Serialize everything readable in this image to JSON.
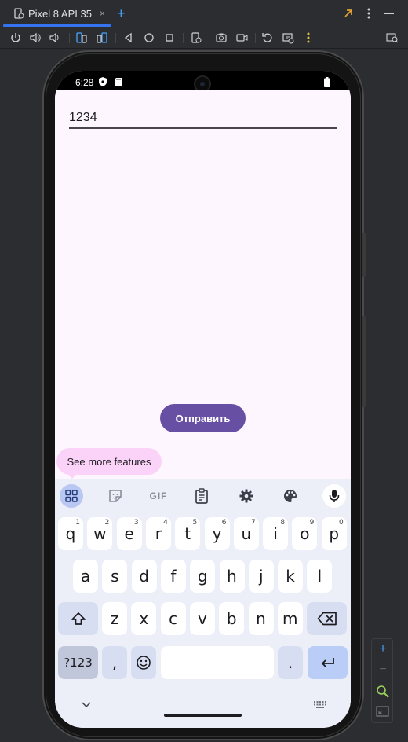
{
  "window": {
    "tab_title": "Pixel 8 API 35",
    "tab_close": "×",
    "tab_add": "+"
  },
  "toolbar": {
    "icons": [
      "power-icon",
      "volume-up-icon",
      "volume-down-icon",
      "rotate-left-icon",
      "rotate-right-icon",
      "back-icon",
      "home-icon",
      "overview-icon",
      "fold-icon",
      "screenshot-icon",
      "record-icon",
      "reset-icon",
      "snapshot-icon",
      "more-icon",
      "search-icon"
    ]
  },
  "status_bar": {
    "time": "6:28"
  },
  "app": {
    "input_value": "1234",
    "send_button": "Отправить",
    "tooltip": "See more features"
  },
  "keyboard": {
    "row1": [
      {
        "key": "q",
        "hint": "1"
      },
      {
        "key": "w",
        "hint": "2"
      },
      {
        "key": "e",
        "hint": "3"
      },
      {
        "key": "r",
        "hint": "4"
      },
      {
        "key": "t",
        "hint": "5"
      },
      {
        "key": "y",
        "hint": "6"
      },
      {
        "key": "u",
        "hint": "7"
      },
      {
        "key": "i",
        "hint": "8"
      },
      {
        "key": "o",
        "hint": "9"
      },
      {
        "key": "p",
        "hint": "0"
      }
    ],
    "row2": [
      "a",
      "s",
      "d",
      "f",
      "g",
      "h",
      "j",
      "k",
      "l"
    ],
    "row3": [
      "z",
      "x",
      "c",
      "v",
      "b",
      "n",
      "m"
    ],
    "symbols_key": "?123",
    "comma_key": ",",
    "period_key": ".",
    "gif_label": "GIF"
  },
  "zoom_panel": {
    "plus": "+",
    "minus": "−"
  },
  "colors": {
    "accent": "#6750a4",
    "tab_underline": "#3574f0",
    "screen_bg": "#fdf6fe",
    "keyboard_bg": "#eceef8"
  }
}
